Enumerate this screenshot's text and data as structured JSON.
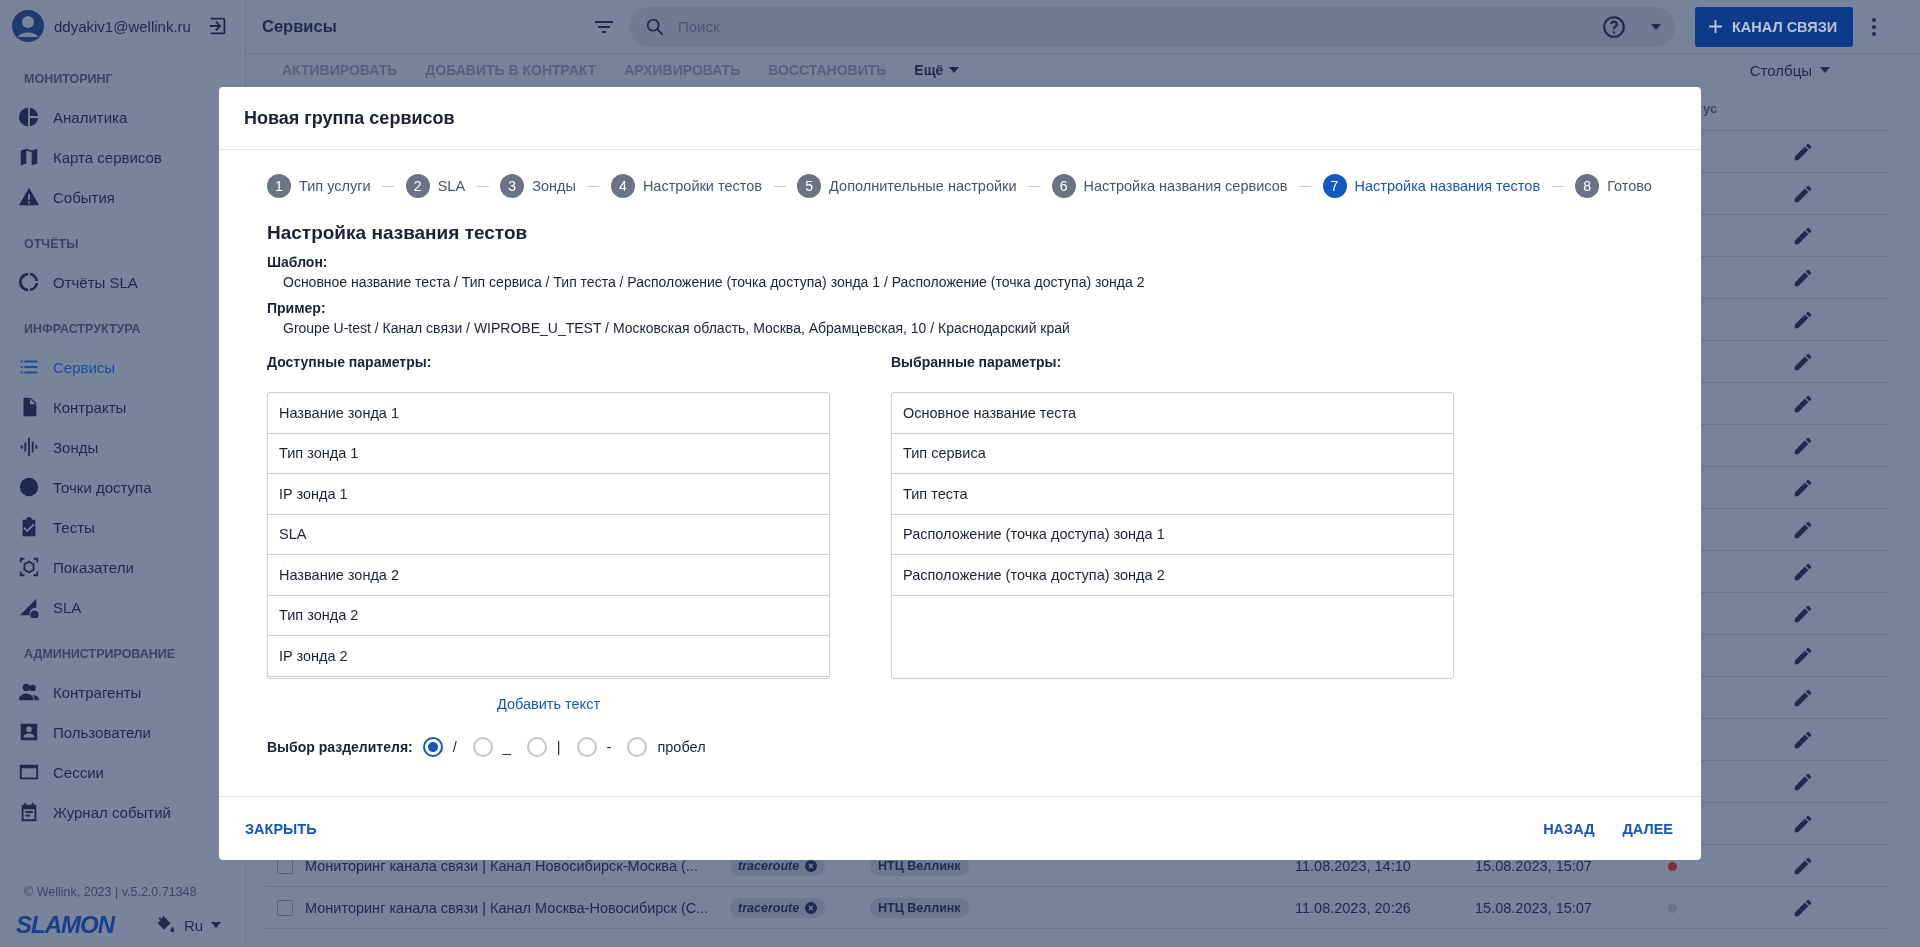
{
  "sidebar": {
    "user": {
      "email": "ddyakiv1@wellink.ru"
    },
    "sections": [
      {
        "title": "МОНИТОРИНГ",
        "items": [
          {
            "label": "Аналитика",
            "selected": false
          },
          {
            "label": "Карта сервисов",
            "selected": false
          },
          {
            "label": "События",
            "selected": false
          }
        ]
      },
      {
        "title": "ОТЧЁТЫ",
        "items": [
          {
            "label": "Отчёты SLA",
            "selected": false
          }
        ]
      },
      {
        "title": "ИНФРАСТРУКТУРА",
        "items": [
          {
            "label": "Сервисы",
            "selected": true
          },
          {
            "label": "Контракты",
            "selected": false
          },
          {
            "label": "Зонды",
            "selected": false
          },
          {
            "label": "Точки доступа",
            "selected": false
          },
          {
            "label": "Тесты",
            "selected": false
          },
          {
            "label": "Показатели",
            "selected": false
          },
          {
            "label": "SLA",
            "selected": false
          }
        ]
      },
      {
        "title": "АДМИНИСТРИРОВАНИЕ",
        "items": [
          {
            "label": "Контрагенты",
            "selected": false
          },
          {
            "label": "Пользователи",
            "selected": false
          },
          {
            "label": "Сессии",
            "selected": false
          },
          {
            "label": "Журнал событий",
            "selected": false
          }
        ]
      }
    ],
    "footer": "© Wellink, 2023 | v.5.2.0.71348",
    "logo": "SLAMON",
    "language": "Ru"
  },
  "topbar": {
    "title": "Сервисы",
    "search": {
      "placeholder": "Поиск"
    },
    "create_button": "КАНАЛ СВЯЗИ"
  },
  "toolbar": {
    "actions": [
      {
        "label": "АКТИВИРОВАТЬ",
        "disabled": true
      },
      {
        "label": "ДОБАВИТЬ В КОНТРАКТ",
        "disabled": true
      },
      {
        "label": "АРХИВИРОВАТЬ",
        "disabled": true
      },
      {
        "label": "ВОССТАНОВИТЬ",
        "disabled": true
      }
    ],
    "more": "Ещё",
    "columns": "Столбцы"
  },
  "table": {
    "header_fragment": "ус",
    "rows": [
      {
        "kind": "covered"
      },
      {
        "kind": "covered"
      },
      {
        "kind": "covered"
      },
      {
        "kind": "covered"
      },
      {
        "kind": "covered"
      },
      {
        "kind": "covered"
      },
      {
        "kind": "covered"
      },
      {
        "kind": "covered"
      },
      {
        "kind": "covered"
      },
      {
        "kind": "covered"
      },
      {
        "kind": "covered"
      },
      {
        "kind": "covered"
      },
      {
        "kind": "covered"
      },
      {
        "kind": "covered"
      },
      {
        "kind": "covered"
      },
      {
        "kind": "covered"
      },
      {
        "kind": "covered"
      },
      {
        "kind": "full",
        "checked": false,
        "name": "Мониторинг канала связи | Канал Новосибирск-Москва (...",
        "tag": "traceroute",
        "org": "НТЦ Веллинк",
        "created": "11.08.2023, 14:10",
        "updated": "15.08.2023, 15:07",
        "color": "#8a2a3a"
      },
      {
        "kind": "full",
        "checked": false,
        "name": "Мониторинг канала связи | Канал Москва-Новосибирск (С...",
        "tag": "traceroute",
        "org": "НТЦ Веллинк",
        "created": "11.08.2023, 20:26",
        "updated": "15.08.2023, 15:07",
        "color": "#66738a"
      }
    ]
  },
  "dialog": {
    "title": "Новая группа сервисов",
    "steps": [
      {
        "number": "1",
        "label": "Тип услуги",
        "selected": false
      },
      {
        "number": "2",
        "label": "SLA",
        "selected": false
      },
      {
        "number": "3",
        "label": "Зонды",
        "selected": false
      },
      {
        "number": "4",
        "label": "Настройки тестов",
        "selected": false
      },
      {
        "number": "5",
        "label": "Дополнительные настройки",
        "selected": false
      },
      {
        "number": "6",
        "label": "Настройка названия сервисов",
        "selected": false
      },
      {
        "number": "7",
        "label": "Настройка названия тестов",
        "selected": true
      },
      {
        "number": "8",
        "label": "Готово",
        "selected": false
      }
    ],
    "heading": "Настройка названия тестов",
    "template_label": "Шаблон:",
    "template": "Основное название теста / Тип сервиса / Тип теста / Расположение (точка доступа) зонда 1 / Расположение (точка доступа) зонда 2",
    "example_label": "Пример:",
    "example": "Groupe U-test / Канал связи / WIPROBE_U_TEST / Московская область, Москва, Абрамцевская, 10 / Краснодарский край",
    "available_label": "Доступные параметры:",
    "available": [
      "Название зонда 1",
      "Тип зонда 1",
      "IP зонда 1",
      "SLA",
      "Название зонда 2",
      "Тип зонда 2",
      "IP зонда 2"
    ],
    "chosen_label": "Выбранные параметры:",
    "chosen": [
      "Основное название теста",
      "Тип сервиса",
      "Тип теста",
      "Расположение (точка доступа) зонда 1",
      "Расположение (точка доступа) зонда 2"
    ],
    "add_text": "Добавить текст",
    "separator_label": "Выбор разделителя:",
    "separators": [
      {
        "label": "/",
        "selected": true
      },
      {
        "label": "_",
        "selected": false
      },
      {
        "label": "|",
        "selected": false
      },
      {
        "label": "-",
        "selected": false
      },
      {
        "label": "пробел",
        "selected": false
      }
    ],
    "buttons": {
      "close": "ЗАКРЫТЬ",
      "back": "НАЗАД",
      "next": "ДАЛЕЕ"
    }
  }
}
